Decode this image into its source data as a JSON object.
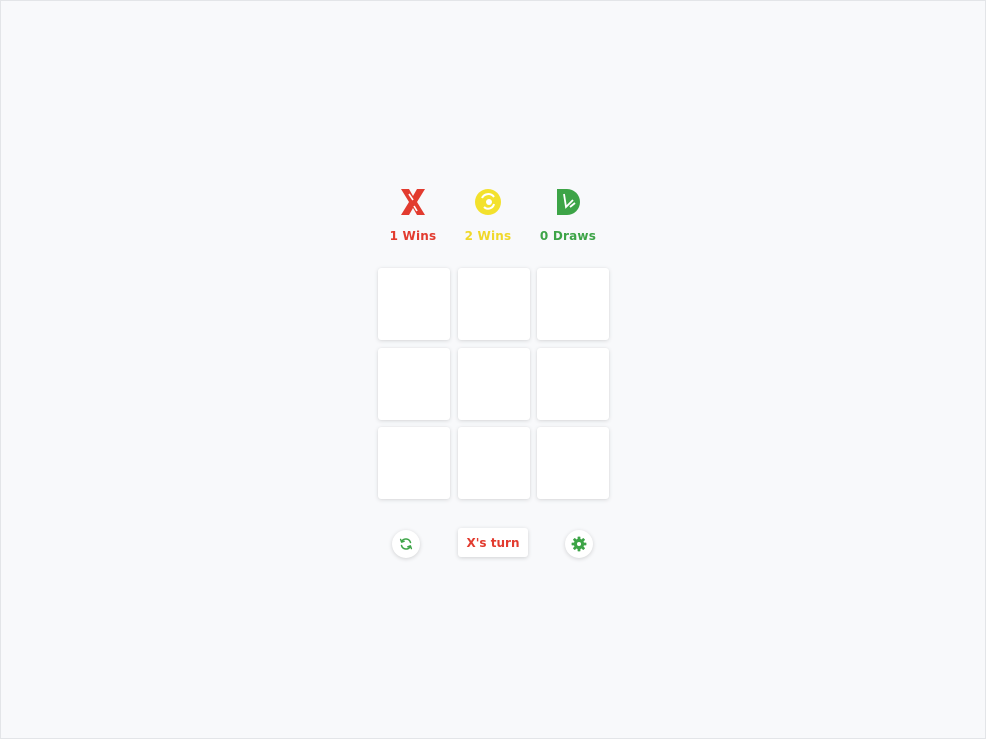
{
  "colors": {
    "x": "#e23b2f",
    "o": "#f3e12c",
    "draw": "#3da447",
    "background": "#f8f9fb",
    "cell": "#ffffff"
  },
  "scores": {
    "x": {
      "icon": "x-player-icon",
      "label": "1 Wins"
    },
    "o": {
      "icon": "o-player-icon",
      "label": "2 Wins"
    },
    "draw": {
      "icon": "draw-icon",
      "label": "0 Draws"
    }
  },
  "board": {
    "cells": [
      "",
      "",
      "",
      "",
      "",
      "",
      "",
      "",
      ""
    ]
  },
  "controls": {
    "reset_icon": "refresh-icon",
    "turn_label": "X's turn",
    "settings_icon": "gear-icon"
  }
}
